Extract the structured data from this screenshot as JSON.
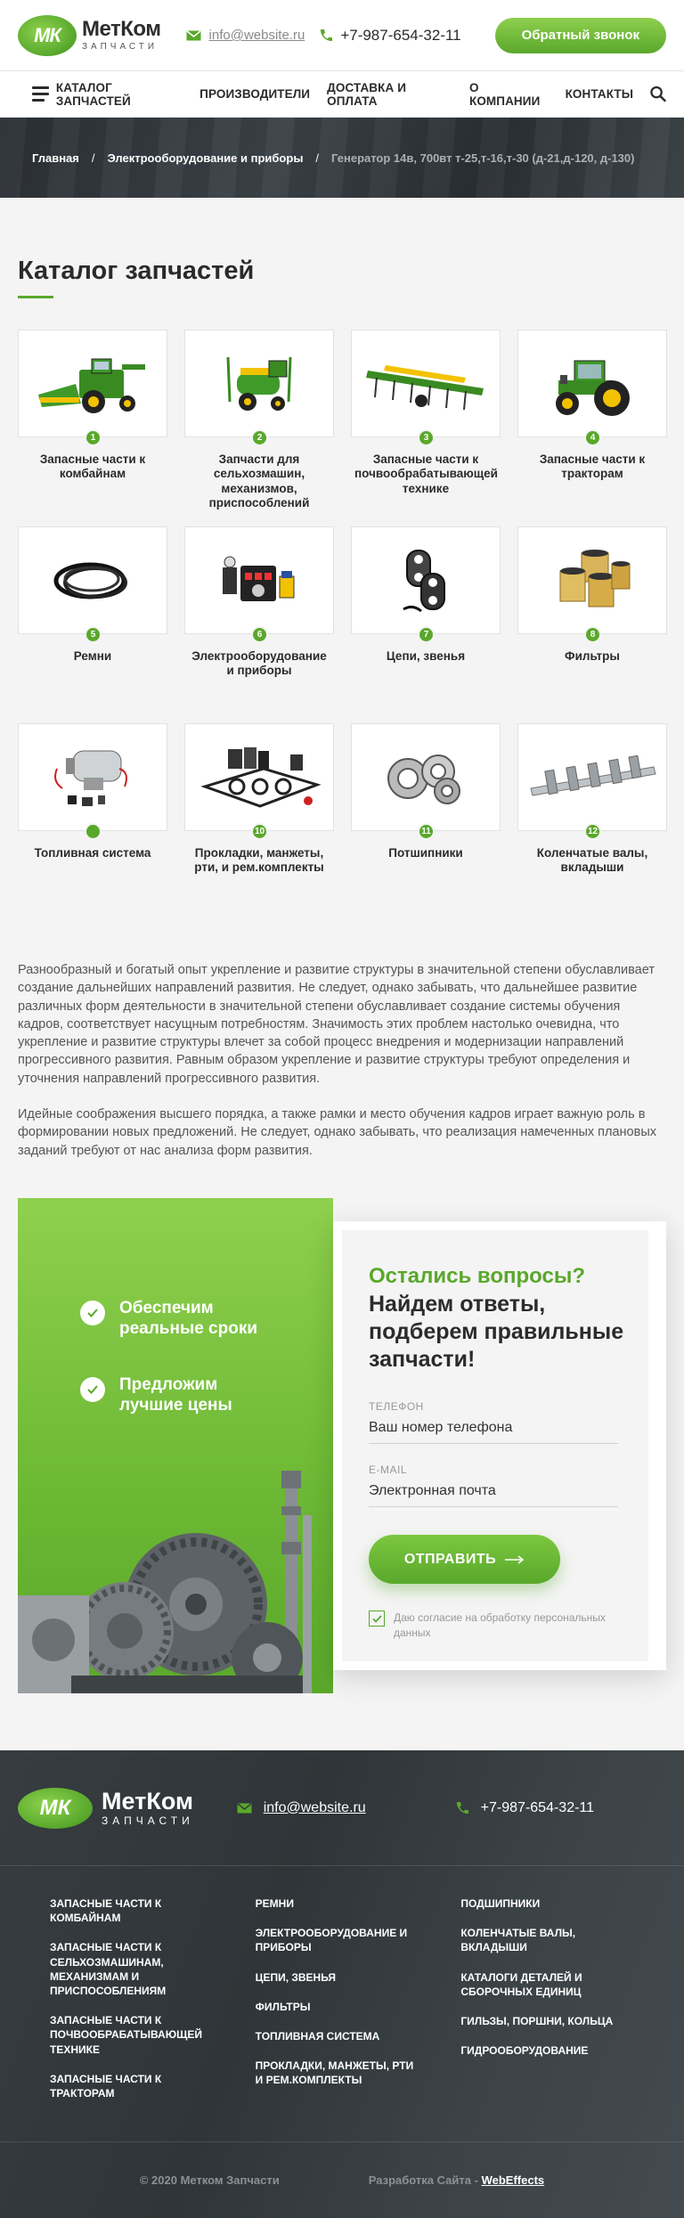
{
  "header": {
    "logo_mark": "МК",
    "logo_name": "МетКом",
    "logo_sub": "ЗАПЧАСТИ",
    "email": "info@website.ru",
    "phone": "+7-987-654-32-11",
    "callback_label": "Обратный звонок"
  },
  "nav": {
    "items": [
      "КАТАЛОГ ЗАПЧАСТЕЙ",
      "ПРОИЗВОДИТЕЛИ",
      "ДОСТАВКА И ОПЛАТА",
      "О КОМПАНИИ",
      "КОНТАКТЫ"
    ]
  },
  "breadcrumbs": [
    "Главная",
    "Электрооборудование и приборы",
    "Генератор 14в, 700вт т-25,т-16,т-30 (д-21,д-120, д-130)"
  ],
  "catalog": {
    "title": "Каталог запчастей",
    "items": [
      {
        "num": "1",
        "label": "Запасные части к комбайнам",
        "icon": "combine-harvester"
      },
      {
        "num": "2",
        "label": "Запчасти для сельхозмашин, механизмов, приспособлений",
        "icon": "sprayer"
      },
      {
        "num": "3",
        "label": "Запасные части к почвообрабатывающей технике",
        "icon": "seeder"
      },
      {
        "num": "4",
        "label": "Запасные части к тракторам",
        "icon": "tractor"
      },
      {
        "num": "5",
        "label": "Ремни",
        "icon": "belts"
      },
      {
        "num": "6",
        "label": "Электрооборудование и приборы",
        "icon": "gauges"
      },
      {
        "num": "7",
        "label": "Цепи, звенья",
        "icon": "chain"
      },
      {
        "num": "8",
        "label": "Фильтры",
        "icon": "filters"
      },
      {
        "num": "",
        "label": "Топливная система",
        "icon": "fuel-pump"
      },
      {
        "num": "10",
        "label": "Прокладки, манжеты, рти, и рем.комплекты",
        "icon": "gasket-kit"
      },
      {
        "num": "11",
        "label": "Потшипники",
        "icon": "bearings"
      },
      {
        "num": "12",
        "label": "Коленчатые валы, вкладыши",
        "icon": "crankshaft"
      }
    ],
    "seo_text": [
      "Разнообразный и богатый опыт укрепление и развитие структуры в значительной степени обуславливает создание дальнейших направлений развития. Не следует, однако забывать, что дальнейшее развитие различных форм деятельности в значительной степени обуславливает создание системы обучения кадров, соответствует насущным потребностям. Значимость этих проблем настолько очевидна, что укрепление и развитие структуры влечет за собой процесс внедрения и модернизации направлений прогрессивного развития. Равным образом укрепление и развитие структуры требуют определения и уточнения направлений прогрессивного развития.",
      "Идейные соображения высшего порядка, а также рамки и место обучения кадров играет важную роль в формировании новых предложений. Не следует, однако забывать, что реализация намеченных плановых заданий требуют от нас анализа форм развития."
    ]
  },
  "promo": {
    "items": [
      "Обеспечим реальные сроки",
      "Предложим лучшие цены"
    ]
  },
  "form": {
    "title_green": "Остались вопросы?",
    "title_dark": "Найдем ответы, подберем правильные запчасти!",
    "phone_label": "ТЕЛЕФОН",
    "phone_placeholder": "Ваш номер телефона",
    "email_label": "E-MAIL",
    "email_placeholder": "Электронная почта",
    "submit_label": "ОТПРАВИТЬ",
    "consent_text": "Даю согласие на обработку персональных данных"
  },
  "footer": {
    "logo_mark": "МК",
    "logo_name": "МетКом",
    "logo_sub": "ЗАПЧАСТИ",
    "email": "info@website.ru",
    "phone": "+7-987-654-32-11",
    "columns": [
      [
        "ЗАПАСНЫЕ ЧАСТИ К КОМБАЙНАМ",
        "ЗАПАСНЫЕ ЧАСТИ К СЕЛЬХОЗМАШИНАМ, МЕХАНИЗМАМ И ПРИСПОСОБЛЕНИЯМ",
        "ЗАПАСНЫЕ ЧАСТИ К ПОЧВООБРАБАТЫВАЮЩЕЙ ТЕХНИКЕ",
        "ЗАПАСНЫЕ ЧАСТИ К ТРАКТОРАМ"
      ],
      [
        "РЕМНИ",
        "ЭЛЕКТРООБОРУДОВАНИЕ И ПРИБОРЫ",
        "ЦЕПИ, ЗВЕНЬЯ",
        "ФИЛЬТРЫ",
        "ТОПЛИВНАЯ СИСТЕМА",
        "ПРОКЛАДКИ, МАНЖЕТЫ, РТИ И РЕМ.КОМПЛЕКТЫ"
      ],
      [
        "ПОДШИПНИКИ",
        "КОЛЕНЧАТЫЕ ВАЛЫ, ВКЛАДЫШИ",
        "КАТАЛОГИ ДЕТАЛЕЙ И СБОРОЧНЫХ ЕДИНИЦ",
        "ГИЛЬЗЫ, ПОРШНИ, КОЛЬЦА",
        "ГИДРООБОРУДОВАНИЕ"
      ]
    ],
    "copyright": "© 2020 Метком Запчасти",
    "dev_prefix": "Разработка Сайта -",
    "dev_link": "WebEffects"
  },
  "colors": {
    "accent": "#5aa82b",
    "accent_light": "#8fd04e",
    "dark": "#2b2b2b",
    "footer_bg": "#363c40"
  }
}
